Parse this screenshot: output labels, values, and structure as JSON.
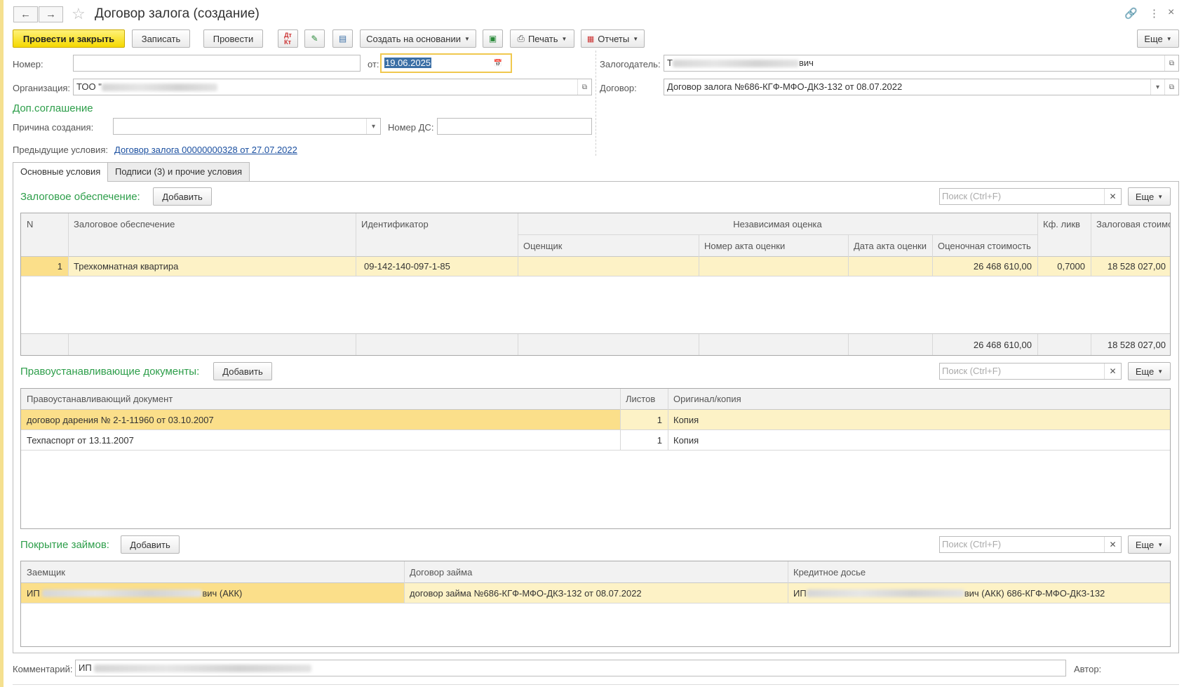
{
  "window": {
    "title": "Договор залога (создание)"
  },
  "toolbar": {
    "post_close": "Провести и закрыть",
    "save": "Записать",
    "post": "Провести",
    "create_based": "Создать на основании",
    "print": "Печать",
    "reports": "Отчеты",
    "more": "Еще"
  },
  "header": {
    "number_label": "Номер:",
    "number_value": "",
    "date_label": "от:",
    "date_value": "19.06.2025",
    "org_label": "Организация:",
    "org_value": "ТОО \"",
    "pledgor_label": "Залогодатель:",
    "pledgor_value_prefix": "Т",
    "pledgor_value_suffix": "вич",
    "contract_label": "Договор:",
    "contract_value": "Договор залога №686-КГФ-МФО-ДКЗ-132 от 08.07.2022"
  },
  "supplement": {
    "title": "Доп.соглашение",
    "reason_label": "Причина создания:",
    "reason_value": "",
    "ds_number_label": "Номер ДС:",
    "ds_number_value": "",
    "prev_label": "Предыдущие условия:",
    "prev_link": "Договор залога 00000000328 от 27.07.2022"
  },
  "tabs": [
    {
      "label": "Основные условия",
      "active": true
    },
    {
      "label": "Подписи (3) и прочие условия",
      "active": false
    }
  ],
  "collateral": {
    "title": "Залоговое обеспечение:",
    "add": "Добавить",
    "search_placeholder": "Поиск (Ctrl+F)",
    "more": "Еще",
    "columns": {
      "n": "N",
      "collateral": "Залоговое обеспечение",
      "identifier": "Идентификатор",
      "independent": "Независимая оценка",
      "appraiser": "Оценщик",
      "act_number": "Номер акта оценки",
      "act_date": "Дата акта оценки",
      "estimated": "Оценочная стоимость",
      "liq": "Кф. ликв",
      "pledge_value": "Залоговая стоимость"
    },
    "rows": [
      {
        "n": "1",
        "collateral": "Трехкомнатная квартира",
        "identifier": "09-142-140-097-1-85",
        "appraiser": "",
        "act_number": "",
        "act_date": "",
        "estimated": "26 468 610,00",
        "liq": "0,7000",
        "pledge_value": "18 528 027,00"
      }
    ],
    "totals": {
      "estimated": "26 468 610,00",
      "pledge_value": "18 528 027,00"
    }
  },
  "title_docs": {
    "title": "Правоустанавливающие документы:",
    "add": "Добавить",
    "search_placeholder": "Поиск (Ctrl+F)",
    "more": "Еще",
    "columns": {
      "doc": "Правоустанавливающий документ",
      "sheets": "Листов",
      "orig": "Оригинал/копия"
    },
    "rows": [
      {
        "doc": "договор дарения № 2-1-11960 от 03.10.2007",
        "sheets": "1",
        "orig": "Копия"
      },
      {
        "doc": "Техпаспорт от 13.11.2007",
        "sheets": "1",
        "orig": "Копия"
      }
    ]
  },
  "loans": {
    "title": "Покрытие займов:",
    "add": "Добавить",
    "search_placeholder": "Поиск (Ctrl+F)",
    "more": "Еще",
    "columns": {
      "borrower": "Заемщик",
      "loan_contract": "Договор займа",
      "credit_file": "Кредитное досье"
    },
    "rows": [
      {
        "borrower_prefix": "ИП ",
        "borrower_suffix": "вич (АКК)",
        "loan_contract": "договор займа №686-КГФ-МФО-ДКЗ-132 от 08.07.2022",
        "credit_prefix": "ИП ",
        "credit_suffix": "вич (АКК) 686-КГФ-МФО-ДКЗ-132"
      }
    ]
  },
  "footer": {
    "comment_label": "Комментарий:",
    "comment_prefix": "ИП ",
    "author_label": "Автор:"
  }
}
